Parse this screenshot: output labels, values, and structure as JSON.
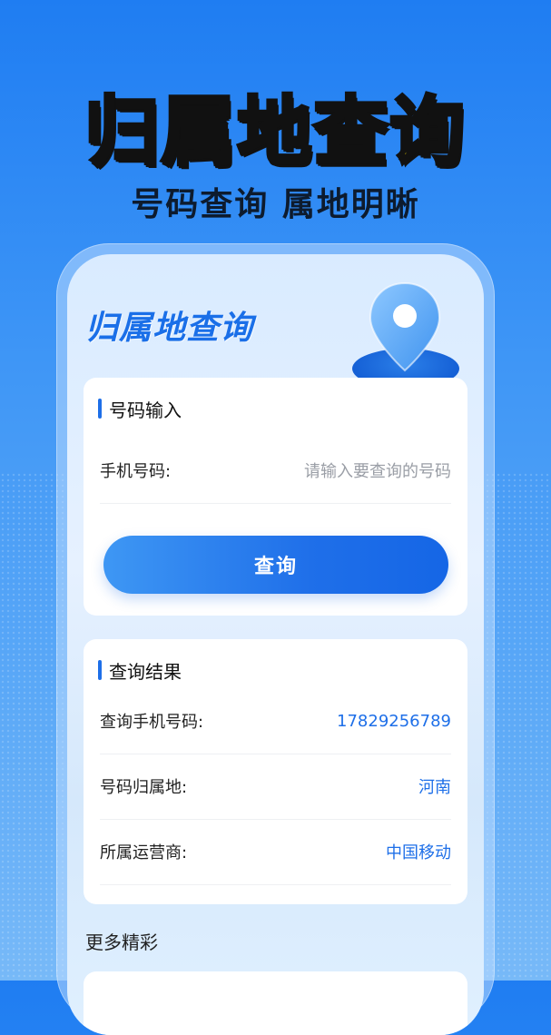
{
  "hero": {
    "title": "归属地查询",
    "subtitle": "号码查询 属地明晰"
  },
  "app": {
    "title": "归属地查询",
    "pin_icon": "location-pin-icon"
  },
  "input_section": {
    "title": "号码输入",
    "phone_label": "手机号码:",
    "phone_placeholder": "请输入要查询的号码",
    "phone_value": "",
    "query_button": "查询"
  },
  "result_section": {
    "title": "查询结果",
    "rows": [
      {
        "label": "查询手机号码:",
        "value": "17829256789"
      },
      {
        "label": "号码归属地:",
        "value": "河南"
      },
      {
        "label": "所属运营商:",
        "value": "中国移动"
      }
    ]
  },
  "more": {
    "title": "更多精彩"
  },
  "colors": {
    "accent": "#1e6fe8",
    "hero_title": "#ffe600",
    "background": "#2d86f4"
  }
}
